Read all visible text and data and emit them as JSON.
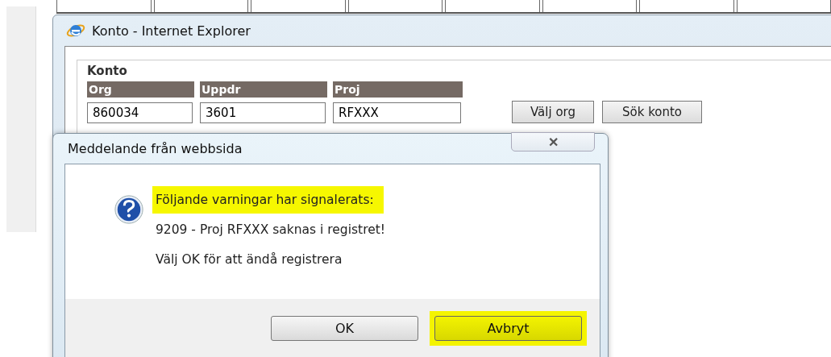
{
  "browser_window": {
    "title": "Konto - Internet Explorer",
    "section": {
      "heading": "Konto",
      "fields": [
        {
          "label": "Org",
          "value": "860034"
        },
        {
          "label": "Uppdr",
          "value": "3601"
        },
        {
          "label": "Proj",
          "value": "RFXXX"
        }
      ],
      "buttons": [
        "Välj org",
        "Sök konto"
      ]
    }
  },
  "dialog": {
    "title": "Meddelande från webbsida",
    "close": "✕",
    "messages": [
      {
        "text": "Följande varningar har signalerats:",
        "highlighted": true
      },
      {
        "text": "9209 - Proj RFXXX saknas i registret!",
        "highlighted": false
      },
      {
        "text": "Välj OK för att ändå registrera",
        "highlighted": false
      }
    ],
    "buttons": [
      {
        "label": "OK",
        "highlighted": false
      },
      {
        "label": "Avbryt",
        "highlighted": true
      }
    ]
  }
}
